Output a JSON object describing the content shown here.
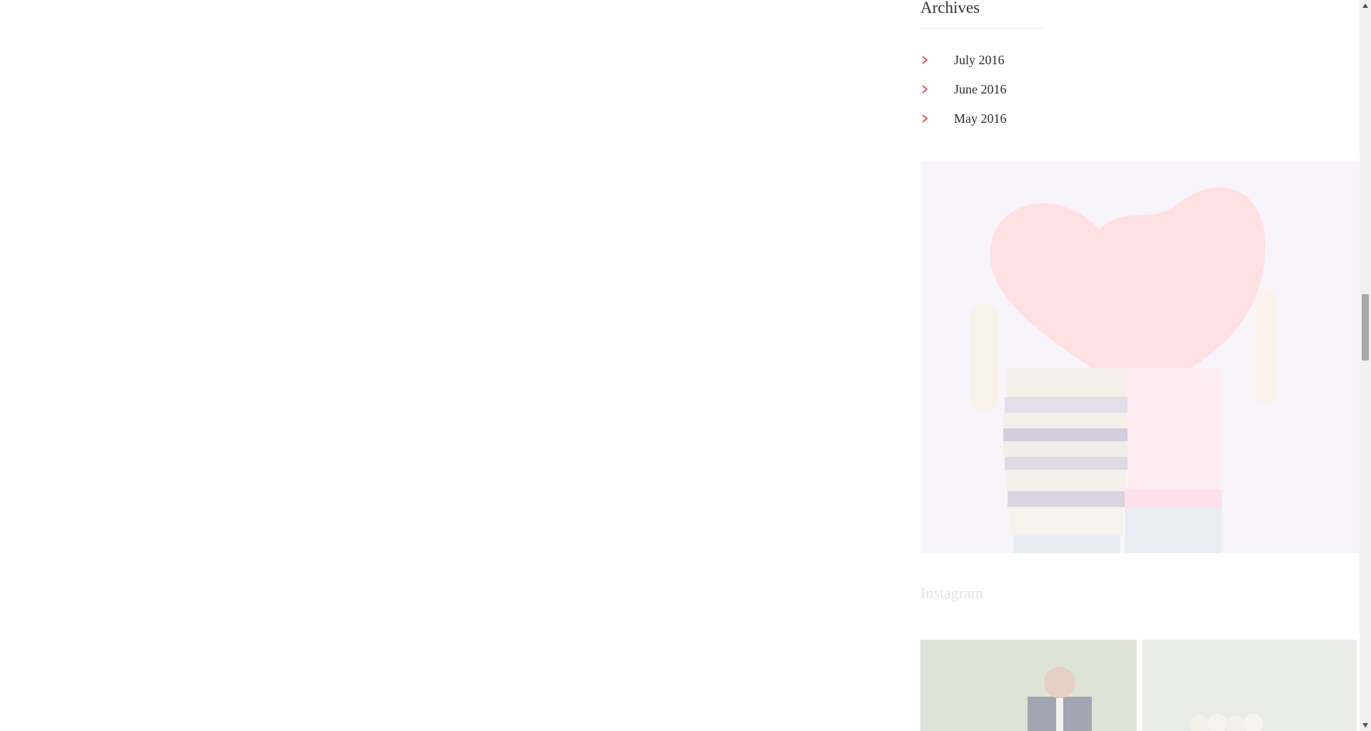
{
  "archives": {
    "title": "Archives",
    "items": [
      {
        "label": "July 2016"
      },
      {
        "label": "June 2016"
      },
      {
        "label": "May 2016"
      }
    ],
    "accent_color": "#e0383e"
  },
  "promo": {
    "icon": "heart-couple-photo"
  },
  "instagram": {
    "title": "Instagram"
  }
}
